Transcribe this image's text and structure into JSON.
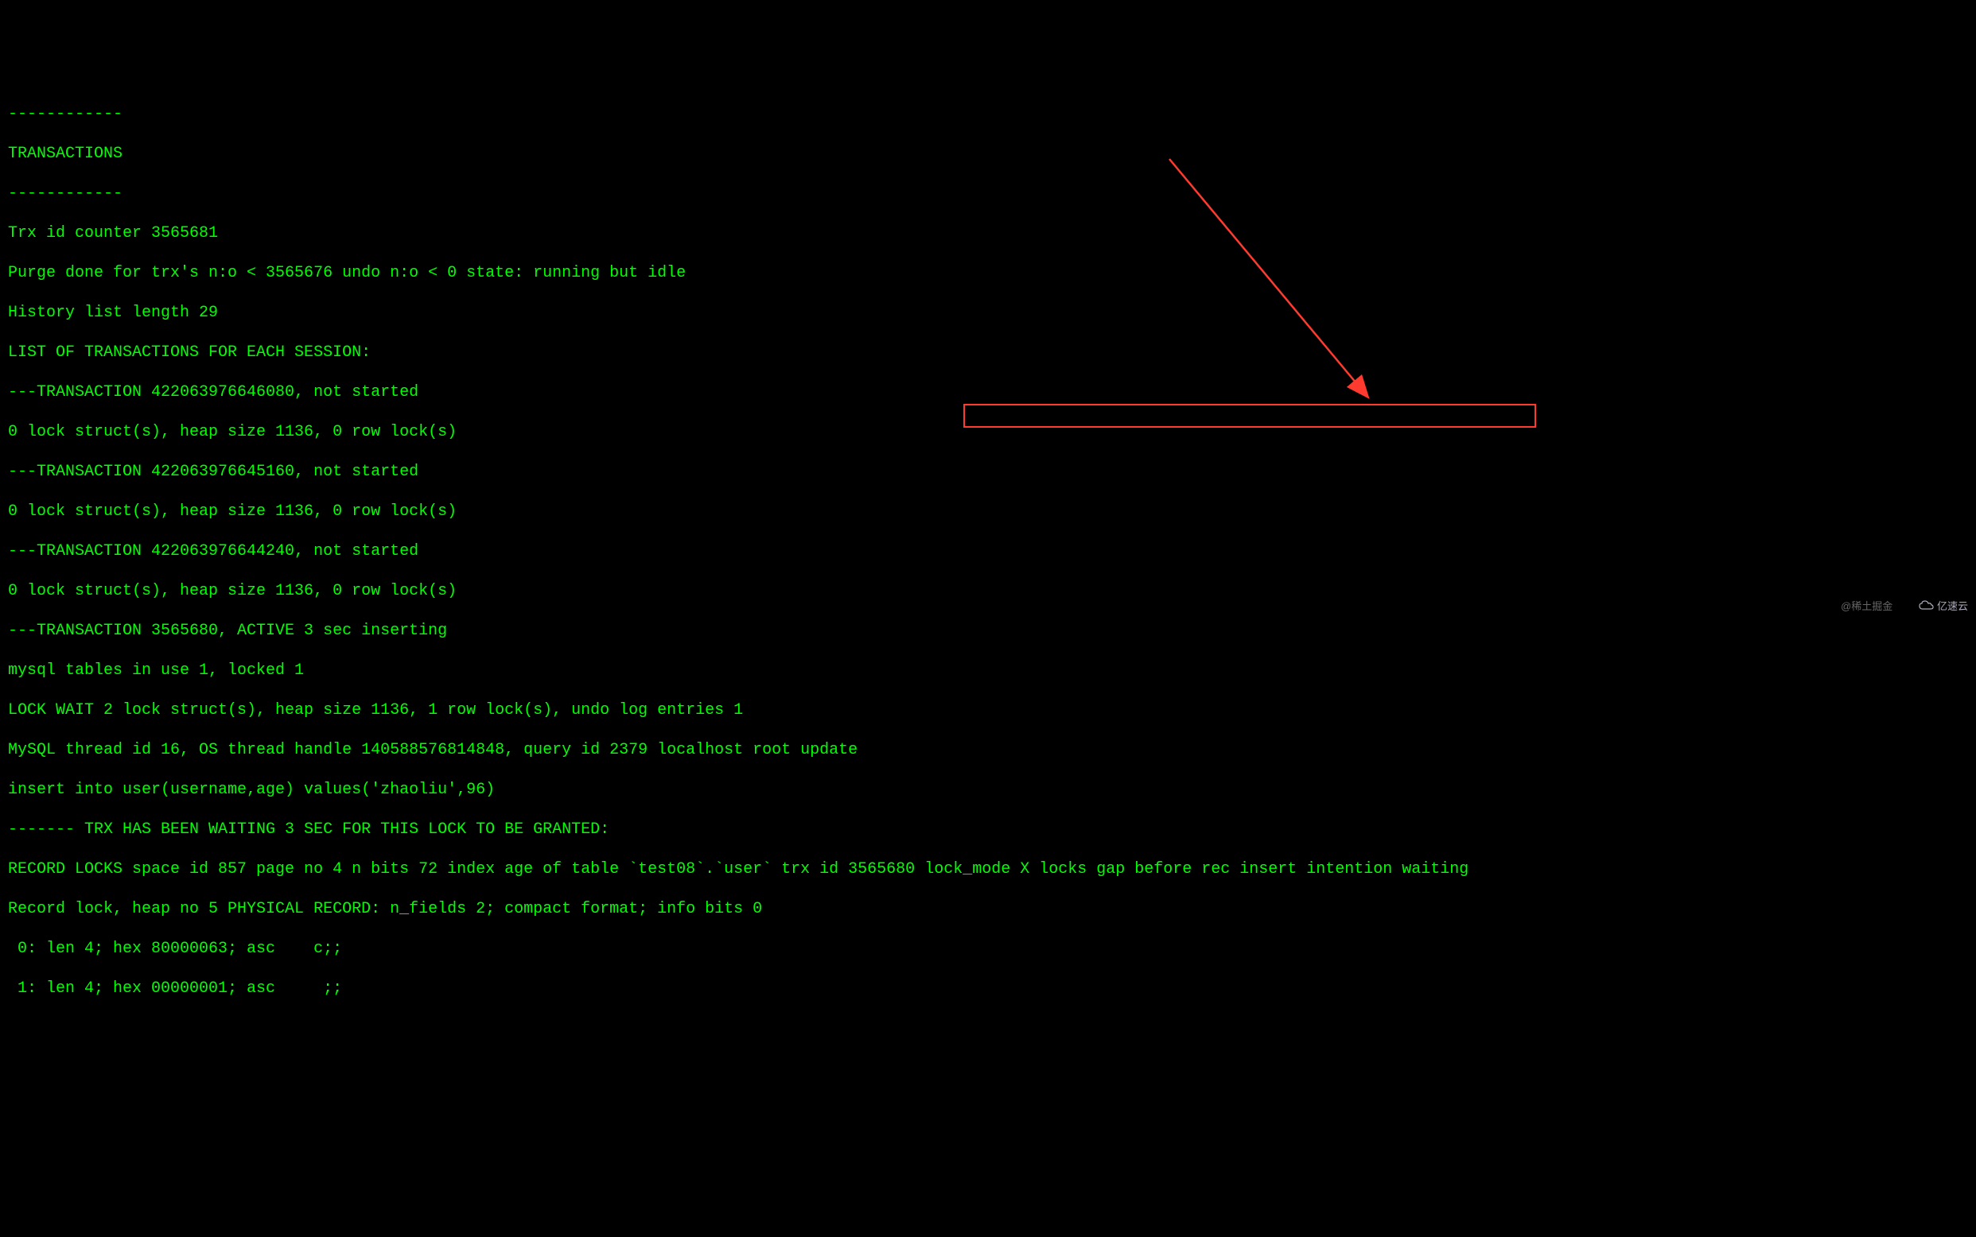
{
  "terminal": {
    "lines": [
      "------------",
      "TRANSACTIONS",
      "------------",
      "Trx id counter 3565681",
      "Purge done for trx's n:o < 3565676 undo n:o < 0 state: running but idle",
      "History list length 29",
      "LIST OF TRANSACTIONS FOR EACH SESSION:",
      "---TRANSACTION 422063976646080, not started",
      "0 lock struct(s), heap size 1136, 0 row lock(s)",
      "---TRANSACTION 422063976645160, not started",
      "0 lock struct(s), heap size 1136, 0 row lock(s)",
      "---TRANSACTION 422063976644240, not started",
      "0 lock struct(s), heap size 1136, 0 row lock(s)",
      "---TRANSACTION 3565680, ACTIVE 3 sec inserting",
      "mysql tables in use 1, locked 1",
      "LOCK WAIT 2 lock struct(s), heap size 1136, 1 row lock(s), undo log entries 1",
      "MySQL thread id 16, OS thread handle 140588576814848, query id 2379 localhost root update",
      "insert into user(username,age) values('zhaoliu',96)",
      "------- TRX HAS BEEN WAITING 3 SEC FOR THIS LOCK TO BE GRANTED:",
      "RECORD LOCKS space id 857 page no 4 n bits 72 index age of table `test08`.`user` trx id 3565680 lock_mode X locks gap before rec insert intention waiting",
      "Record lock, heap no 5 PHYSICAL RECORD: n_fields 2; compact format; info bits 0",
      " 0: len 4; hex 80000063; asc    c;;",
      " 1: len 4; hex 00000001; asc     ;;"
    ]
  },
  "annotation": {
    "highlight_text": "lock_mode X locks gap before rec insert intention waiting",
    "arrow_color": "#ff3b30",
    "box_color": "#ff3b30"
  },
  "watermark": {
    "left": "@稀土掘金",
    "right": "亿速云"
  }
}
